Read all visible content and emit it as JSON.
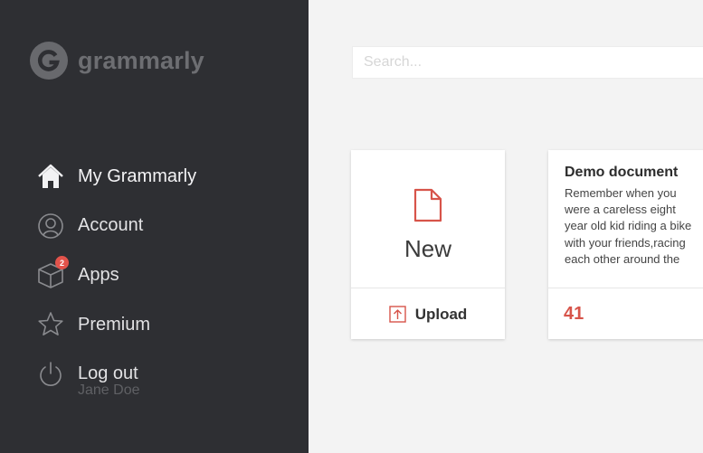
{
  "app": {
    "name": "grammarly"
  },
  "sidebar": {
    "items": [
      {
        "label": "My Grammarly",
        "icon": "home-icon"
      },
      {
        "label": "Account",
        "icon": "user-icon"
      },
      {
        "label": "Apps",
        "icon": "box-icon",
        "badge": "2"
      },
      {
        "label": "Premium",
        "icon": "star-icon"
      },
      {
        "label": "Log out",
        "icon": "power-icon"
      }
    ],
    "user_name": "Jane Doe"
  },
  "search": {
    "placeholder": "Search...",
    "value": ""
  },
  "cards": {
    "new": {
      "label": "New",
      "upload_label": "Upload"
    },
    "demo": {
      "title": "Demo document",
      "excerpt": "Remember when you were a careless eight year old kid riding a bike with your friends,racing each other around the",
      "score": "41"
    }
  },
  "colors": {
    "sidebar_bg": "#2e2f33",
    "accent": "#d7544a",
    "badge": "#e2534b",
    "content_bg": "#f3f3f3"
  }
}
